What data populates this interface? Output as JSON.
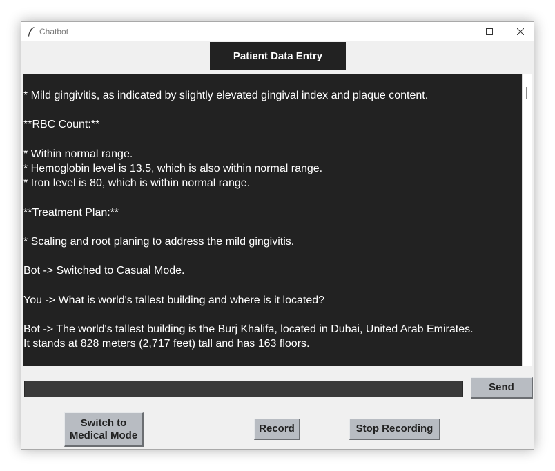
{
  "window": {
    "title": "Chatbot",
    "controls": {
      "minimize": "minimize-icon",
      "maximize": "maximize-icon",
      "close": "close-icon"
    }
  },
  "header": {
    "label": "Patient Data Entry"
  },
  "chat": {
    "text": "* Mild gingivitis, as indicated by slightly elevated gingival index and plaque content.\n\n**RBC Count:**\n\n* Within normal range.\n* Hemoglobin level is 13.5, which is also within normal range.\n* Iron level is 80, which is within normal range.\n\n**Treatment Plan:**\n\n* Scaling and root planing to address the mild gingivitis.\n\nBot -> Switched to Casual Mode.\n\nYou -> What is world's tallest building and where is it located?\n\nBot -> The world's tallest building is the Burj Khalifa, located in Dubai, United Arab Emirates.\nIt stands at 828 meters (2,717 feet) tall and has 163 floors."
  },
  "input": {
    "value": ""
  },
  "buttons": {
    "send": "Send",
    "switch_mode": "Switch to\nMedical Mode",
    "record": "Record",
    "stop_recording": "Stop Recording"
  },
  "colors": {
    "dark_bg": "#222222",
    "button_bg": "#b8bcc2",
    "window_bg": "#f0f0f0"
  }
}
